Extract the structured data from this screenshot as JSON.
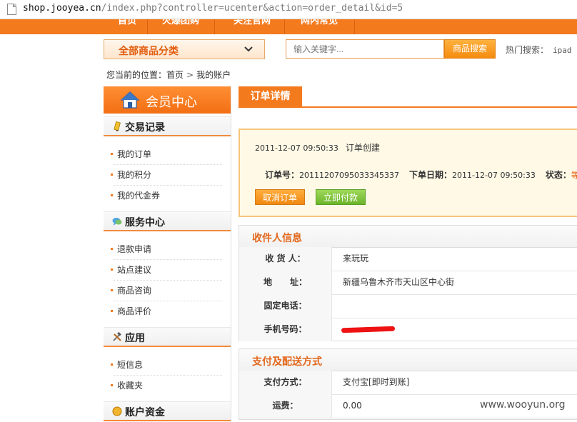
{
  "browser": {
    "url_host": "shop.jooyea.cn",
    "url_path": "/index.php?controller=ucenter&action=order_detail&id=5"
  },
  "topnav": {
    "items": [
      "首页",
      "火爆团购",
      "关注官网",
      "网内常见"
    ]
  },
  "search": {
    "category_label": "全部商品分类",
    "placeholder": "输入关键字...",
    "button_label": "商品搜索",
    "hot_label": "热门搜索：",
    "hot_keyword": "ipad"
  },
  "breadcrumb": {
    "prefix": "您当前的位置：",
    "home": "首页",
    "separator": ">",
    "current": "我的账户"
  },
  "sidebar": {
    "header_title": "会员中心",
    "sections": [
      {
        "title": "交易记录",
        "icon": "pencil-icon",
        "items": [
          "我的订单",
          "我的积分",
          "我的代金券"
        ]
      },
      {
        "title": "服务中心",
        "icon": "chat-bubble-icon",
        "items": [
          "退款申请",
          "站点建议",
          "商品咨询",
          "商品评价"
        ]
      },
      {
        "title": "应用",
        "icon": "tools-icon",
        "items": [
          "短信息",
          "收藏夹"
        ]
      },
      {
        "title": "账户资金",
        "icon": "coin-icon",
        "items": []
      }
    ]
  },
  "main": {
    "tab_title": "订单详情",
    "order_log": {
      "time": "2011-12-07 09:50:33",
      "event": "订单创建"
    },
    "order_meta": {
      "number_label": "订单号：",
      "number": "20111207095033345337",
      "date_label": "下单日期：",
      "date": "2011-12-07 09:50:33",
      "status_label": "状态：",
      "status_value": "等"
    },
    "buttons": {
      "cancel": "取消订单",
      "pay": "立即付款"
    },
    "receiver": {
      "title": "收件人信息",
      "rows": [
        {
          "label": "收 货 人：",
          "value": "来玩玩"
        },
        {
          "label": "地      址：",
          "value": "新疆乌鲁木齐市天山区中心街"
        },
        {
          "label": "固定电话：",
          "value": ""
        },
        {
          "label": "手机号码：",
          "value": ""
        }
      ]
    },
    "payment": {
      "title": "支付及配送方式",
      "rows": [
        {
          "label": "支付方式：",
          "value": "支付宝[即时到账]"
        },
        {
          "label": "运费：",
          "value": "0.00"
        }
      ]
    }
  },
  "watermark": "www.wooyun.org",
  "colors": {
    "accent": "#f47a1e",
    "pay_green": "#6cb52b",
    "panel_title": "#e2671c"
  }
}
